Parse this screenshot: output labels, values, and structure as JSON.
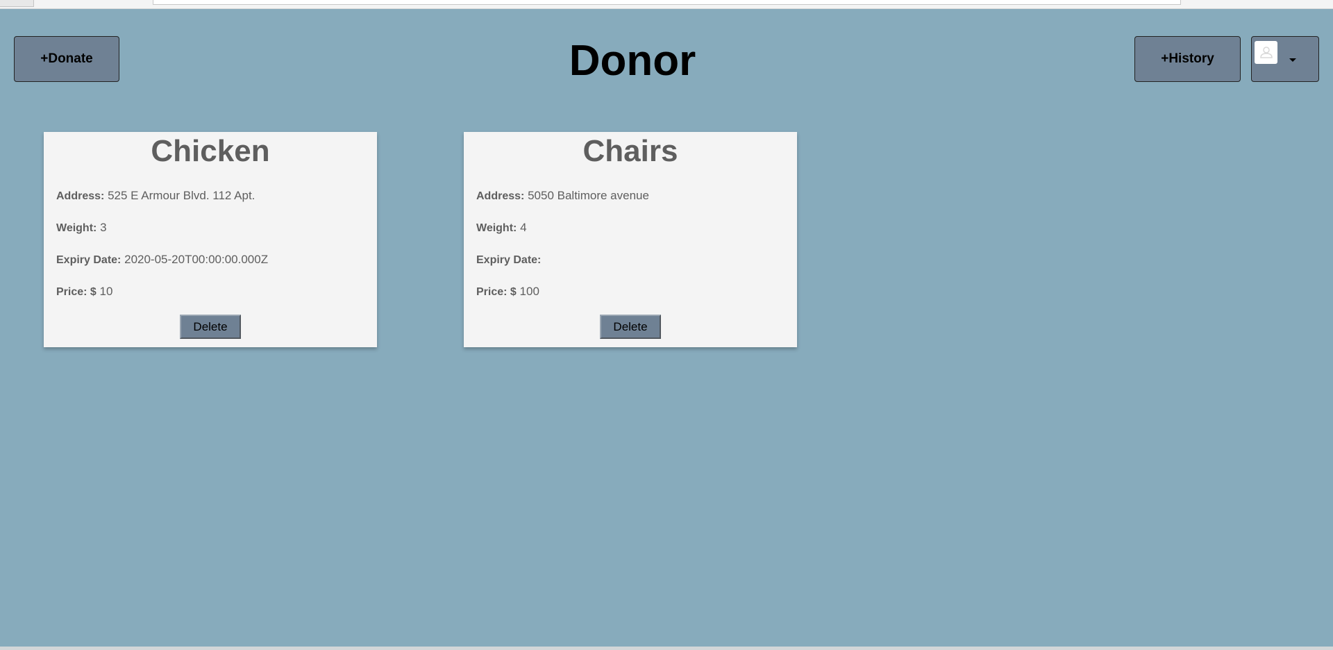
{
  "header": {
    "donate_label": "+Donate",
    "title": "Donor",
    "history_label": "+History"
  },
  "colors": {
    "background": "#87abbc",
    "button": "#6f8194",
    "card": "#f4f4f4",
    "card_text": "#5e5e5e"
  },
  "cards": [
    {
      "title": "Chicken",
      "address_label": "Address:",
      "address": "525 E Armour Blvd. 112 Apt.",
      "weight_label": "Weight:",
      "weight": "3",
      "expiry_label": "Expiry Date:",
      "expiry": "2020-05-20T00:00:00.000Z",
      "price_label": "Price: $",
      "price": "10",
      "delete_label": "Delete"
    },
    {
      "title": "Chairs",
      "address_label": "Address:",
      "address": "5050 Baltimore avenue",
      "weight_label": "Weight:",
      "weight": "4",
      "expiry_label": "Expiry Date:",
      "expiry": "",
      "price_label": "Price: $",
      "price": "100",
      "delete_label": "Delete"
    }
  ]
}
